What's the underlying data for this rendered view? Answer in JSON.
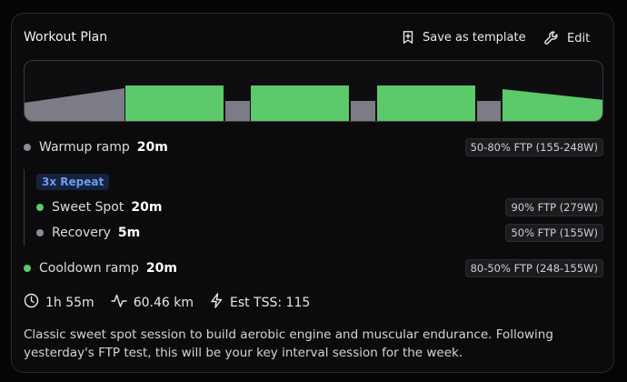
{
  "header": {
    "title": "Workout Plan",
    "save_template_label": "Save as template",
    "edit_label": "Edit"
  },
  "colors": {
    "work": "#5cc96a",
    "rest": "#7c7c86",
    "repeat_accent": "#6f9cf0"
  },
  "steps": {
    "warmup": {
      "label": "Warmup ramp",
      "duration": "20m",
      "target": "50-80% FTP (155-248W)"
    },
    "repeat": {
      "badge": "3x Repeat",
      "sweet_spot": {
        "label": "Sweet Spot",
        "duration": "20m",
        "target": "90% FTP (279W)"
      },
      "recovery": {
        "label": "Recovery",
        "duration": "5m",
        "target": "50% FTP (155W)"
      }
    },
    "cooldown": {
      "label": "Cooldown ramp",
      "duration": "20m",
      "target": "80-50% FTP (248-155W)"
    }
  },
  "stats": {
    "duration": "1h 55m",
    "distance": "60.46 km",
    "tss": "Est TSS: 115"
  },
  "description": "Classic sweet spot session to build aerobic engine and muscular endurance. Following yesterday's FTP test, this will be your key interval session for the week."
}
